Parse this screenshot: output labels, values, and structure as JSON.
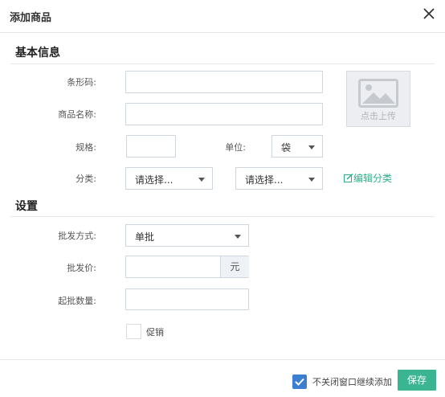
{
  "dialog": {
    "title": "添加商品"
  },
  "basic_section": {
    "title": "基本信息",
    "barcode_label": "条形码:",
    "name_label": "商品名称:",
    "spec_label": "规格:",
    "unit_label": "单位:",
    "unit_value": "袋",
    "category_label": "分类:",
    "category1_value": "请选择...",
    "category2_value": "请选择...",
    "edit_category_label": "编辑分类",
    "upload_label": "点击上传"
  },
  "settings_section": {
    "title": "设置",
    "wholesale_method_label": "批发方式:",
    "wholesale_method_value": "单批",
    "wholesale_price_label": "批发价:",
    "price_unit": "元",
    "min_qty_label": "起批数量:",
    "promo_label": "促销"
  },
  "footer": {
    "keep_open_label": "不关闭窗口继续添加",
    "save_label": "保存"
  },
  "colors": {
    "accent": "#3bb591",
    "checkbox": "#3c7fd0",
    "link": "#2db08a"
  }
}
